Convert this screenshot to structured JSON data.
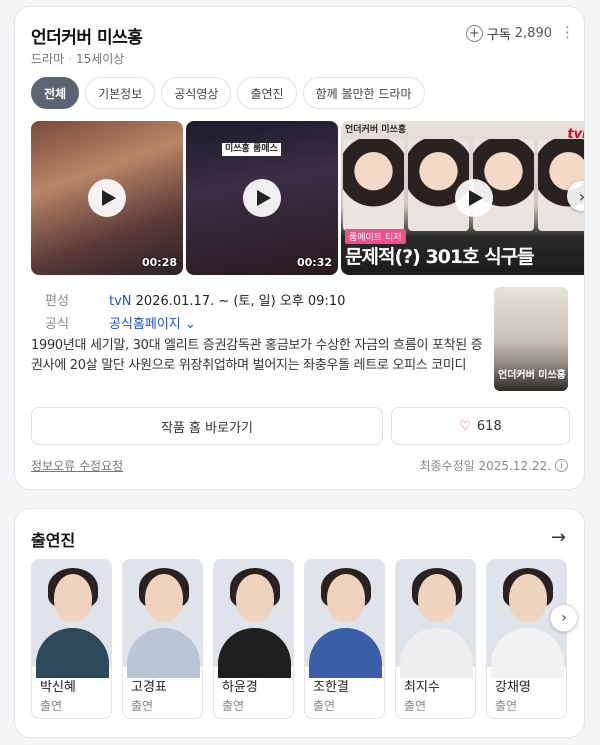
{
  "header": {
    "title": "언더커버 미쓰홍",
    "genre": "드라마",
    "rating": "15세이상",
    "subscribe_label": "구독",
    "subscribe_count": "2,890",
    "more_icon": "more-vertical-icon"
  },
  "tabs": [
    {
      "label": "전체",
      "active": true
    },
    {
      "label": "기본정보",
      "active": false
    },
    {
      "label": "공식영상",
      "active": false
    },
    {
      "label": "출연진",
      "active": false
    },
    {
      "label": "함께 볼만한 드라마",
      "active": false
    }
  ],
  "videos": [
    {
      "duration": "00:28",
      "caption": ""
    },
    {
      "duration": "00:32",
      "caption": "미쓰홍 룸메스"
    },
    {
      "duration": "",
      "badge": "룸메이트 티저",
      "headline": "문제적(?) 301호 식구들",
      "channel": "tvN",
      "show_logo": "언더커버 미쓰홍"
    }
  ],
  "info": {
    "broadcast_label": "편성",
    "channel": "tvN",
    "schedule": "2026.01.17. ~ (토, 일) 오후 09:10",
    "official_label": "공식",
    "official_link": "공식홈페이지",
    "description": "1990년대 세기말, 30대 엘리트 증권감독관 홍금보가 수상한 자금의 흐름이 포착된 증권사에 20살 말단 사원으로 위장취업하며 벌어지는 좌충우돌 레트로 오피스 코미디",
    "poster_title": "언더커버 미쓰홍"
  },
  "actions": {
    "home_button": "작품 홈 바로가기",
    "like_count": "618"
  },
  "footer": {
    "report_link": "정보오류 수정요청",
    "updated": "최종수정일 2025.12.22."
  },
  "cast": {
    "title": "출연진",
    "members": [
      {
        "name": "박신혜",
        "role": "출연",
        "outfit": "#2d4a5a"
      },
      {
        "name": "고경표",
        "role": "출연",
        "outfit": "#b9c6d6"
      },
      {
        "name": "하윤경",
        "role": "출연",
        "outfit": "#1f1f1f"
      },
      {
        "name": "조한결",
        "role": "출연",
        "outfit": "#3a5ea8"
      },
      {
        "name": "최지수",
        "role": "출연",
        "outfit": "#eeeeee"
      },
      {
        "name": "강채영",
        "role": "출연",
        "outfit": "#f2f2f2"
      }
    ]
  },
  "colors": {
    "accent_link": "#2052c9",
    "tab_active": "#5b6571",
    "heart": "#e23b4b"
  }
}
